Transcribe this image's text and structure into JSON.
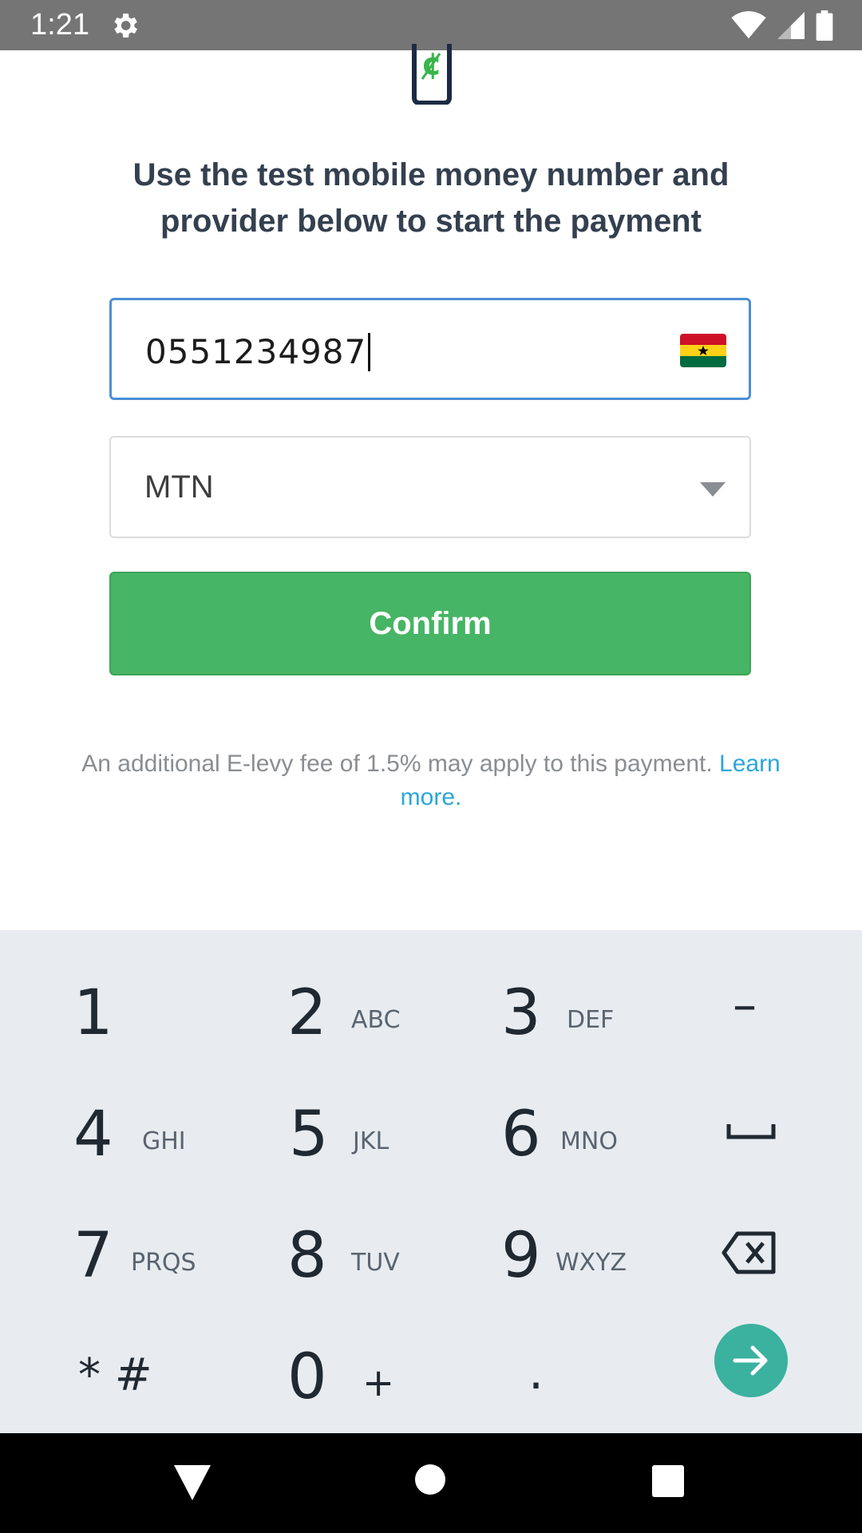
{
  "status_bar": {
    "time": "1:21"
  },
  "instructions": "Use the test mobile money number and provider below to start the payment",
  "phone_field": {
    "value": "0551234987"
  },
  "provider_select": {
    "value": "MTN"
  },
  "confirm_label": "Confirm",
  "levy_note": {
    "text": "An additional E-levy fee of 1.5% may apply to this payment. ",
    "link": "Learn more."
  },
  "keyboard": {
    "keys": [
      {
        "num": "1",
        "letters": ""
      },
      {
        "num": "2",
        "letters": "ABC"
      },
      {
        "num": "3",
        "letters": "DEF"
      },
      {
        "num": "–",
        "letters": ""
      },
      {
        "num": "4",
        "letters": "GHI"
      },
      {
        "num": "5",
        "letters": "JKL"
      },
      {
        "num": "6",
        "letters": "MNO"
      },
      {
        "num": "7",
        "letters": "PRQS"
      },
      {
        "num": "8",
        "letters": "TUV"
      },
      {
        "num": "9",
        "letters": "WXYZ"
      },
      {
        "num": "* #",
        "letters": ""
      },
      {
        "num": "0",
        "letters": "+"
      },
      {
        "num": ".",
        "letters": ""
      }
    ]
  },
  "colors": {
    "accent_blue": "#4b8ed6",
    "confirm_green": "#46b565",
    "link_blue": "#2aa7d9",
    "go_teal": "#3bb1a0"
  }
}
